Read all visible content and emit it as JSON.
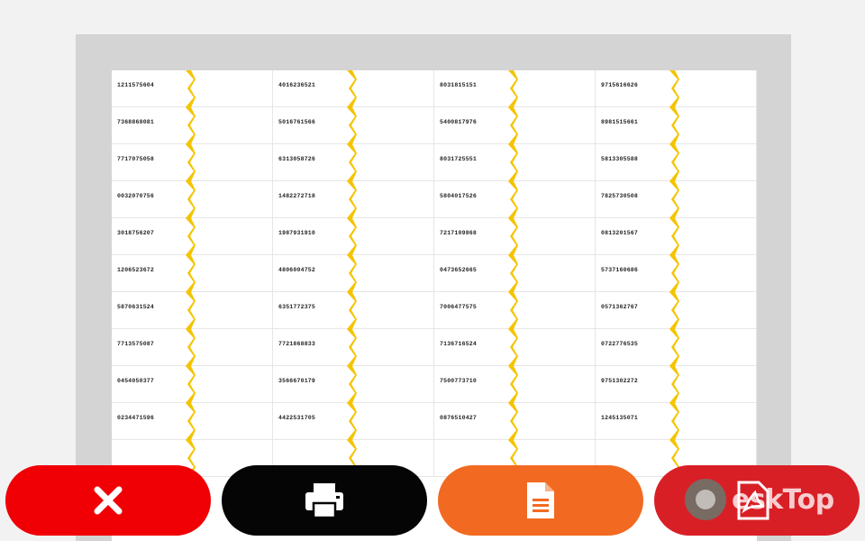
{
  "colors": {
    "close": "#f00004",
    "print": "#050505",
    "document": "#f26a21",
    "pdf": "#d91f26",
    "chevron": "#f5c400",
    "preview_frame": "#d4d4d4"
  },
  "toolbar": {
    "close_icon": "close-icon",
    "print_icon": "printer-icon",
    "document_icon": "document-icon",
    "pdf_icon": "pdf-icon"
  },
  "watermark": {
    "text": "eskTop"
  },
  "tickets": [
    "1211575604",
    "4016236521",
    "8031815151",
    "9715616626",
    "7368868081",
    "5016761566",
    "5400817976",
    "8981515661",
    "7717075058",
    "6313058726",
    "8031725551",
    "5813305588",
    "0032070756",
    "1482272718",
    "5804017526",
    "7825730508",
    "3018756207",
    "1987931910",
    "7217109868",
    "0813201567",
    "1206523672",
    "4806004752",
    "0473652665",
    "5737160686",
    "5870631524",
    "6351772375",
    "7006477575",
    "0571362767",
    "7713575087",
    "7721868833",
    "7136716524",
    "0722776535",
    "0454050377",
    "3566670179",
    "7500773710",
    "9751302272",
    "0234471596",
    "4422531705",
    "0876510427",
    "1245135071",
    "",
    "",
    "",
    ""
  ]
}
